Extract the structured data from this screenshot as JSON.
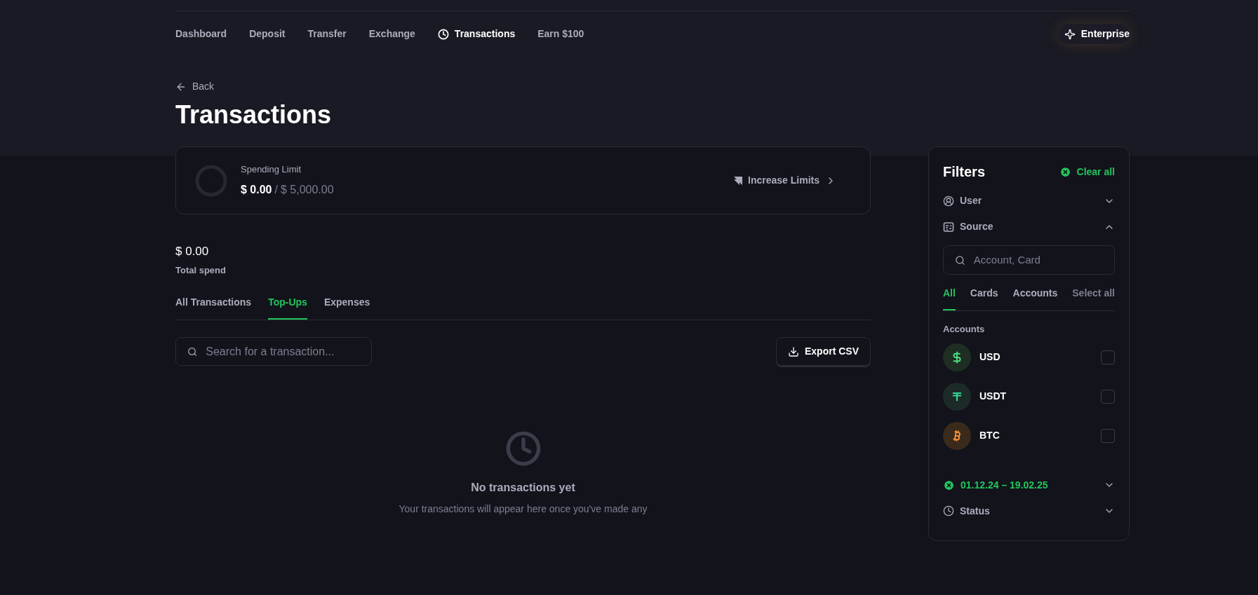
{
  "nav": {
    "items": [
      {
        "label": "Dashboard",
        "selected": false
      },
      {
        "label": "Deposit",
        "selected": false
      },
      {
        "label": "Transfer",
        "selected": false
      },
      {
        "label": "Exchange",
        "selected": false
      },
      {
        "label": "Transactions",
        "selected": true
      },
      {
        "label": "Earn $100",
        "selected": false
      }
    ],
    "enterprise": "Enterprise"
  },
  "back": "Back",
  "title": "Transactions",
  "spending_limit": {
    "label": "Spending Limit",
    "spent": "$ 0.00",
    "separator": "/",
    "limit": "$ 5,000.00",
    "level": 0,
    "action": "Increase Limits"
  },
  "total": {
    "amount": "$ 0.00",
    "label": "Total spend"
  },
  "tabs": [
    {
      "label": "All Transactions",
      "selected": false
    },
    {
      "label": "Top-Ups",
      "selected": true
    },
    {
      "label": "Expenses",
      "selected": false
    }
  ],
  "search": {
    "placeholder": "Search for a transaction..."
  },
  "export_button": "Export CSV",
  "empty": {
    "title": "No transactions yet",
    "text": "Your transactions will appear here once you've made any"
  },
  "filters": {
    "title": "Filters",
    "clear": "Clear all",
    "sections": [
      {
        "kind": "user",
        "label": "User",
        "expanded": false
      },
      {
        "kind": "source",
        "label": "Source",
        "expanded": true
      }
    ],
    "source": {
      "placeholder": "Account, Card",
      "tabs": [
        {
          "label": "All",
          "selected": true
        },
        {
          "label": "Cards",
          "selected": false
        },
        {
          "label": "Accounts",
          "selected": false
        }
      ],
      "select_all": "Select all",
      "group": "Accounts",
      "accounts": [
        {
          "kind": "usd",
          "name": "USD",
          "checked": false
        },
        {
          "kind": "usdt",
          "name": "USDT",
          "checked": false
        },
        {
          "kind": "btc",
          "name": "BTC",
          "checked": false
        }
      ]
    },
    "bottom": [
      {
        "kind": "date",
        "label": "01.12.24 – 19.02.25",
        "expanded": false
      },
      {
        "kind": "status",
        "label": "Status",
        "expanded": false
      }
    ]
  }
}
